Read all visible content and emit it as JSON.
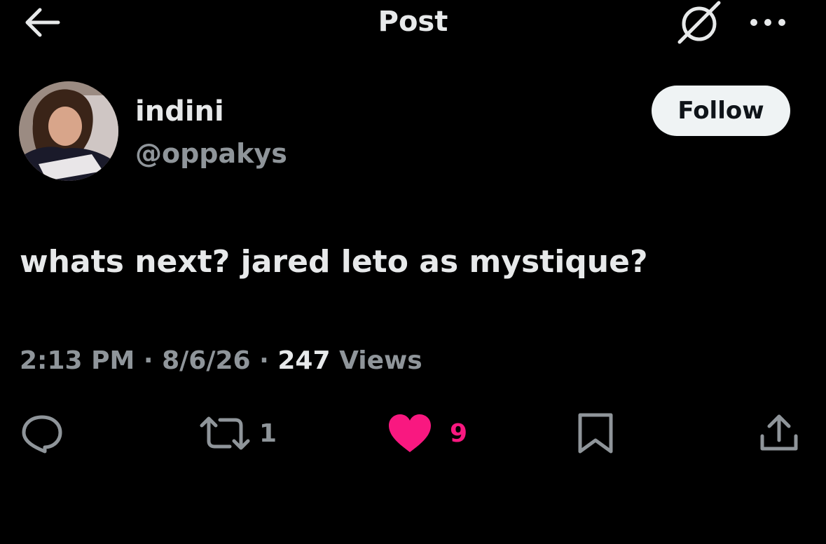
{
  "header": {
    "title": "Post",
    "back_icon": "arrow-left-icon",
    "grok_icon": "grok-icon",
    "more_icon": "ellipsis-icon"
  },
  "author": {
    "display_name": "indini",
    "handle": "@oppakys",
    "follow_label": "Follow"
  },
  "post": {
    "text": "whats next? jared leto as mystique?",
    "time": "2:13 PM",
    "date": "8/6/26",
    "separator": "·",
    "views_count": "247",
    "views_label": "Views"
  },
  "actions": {
    "reply": {
      "icon": "reply-icon",
      "count": ""
    },
    "repost": {
      "icon": "repost-icon",
      "count": "1"
    },
    "like": {
      "icon": "heart-icon",
      "count": "9",
      "active": true
    },
    "bookmark": {
      "icon": "bookmark-icon"
    },
    "share": {
      "icon": "share-icon"
    }
  },
  "colors": {
    "background": "#000000",
    "primary_text": "#e7e9ea",
    "secondary_text": "#8f959a",
    "like_active": "#f91880",
    "follow_bg": "#eff3f4"
  }
}
